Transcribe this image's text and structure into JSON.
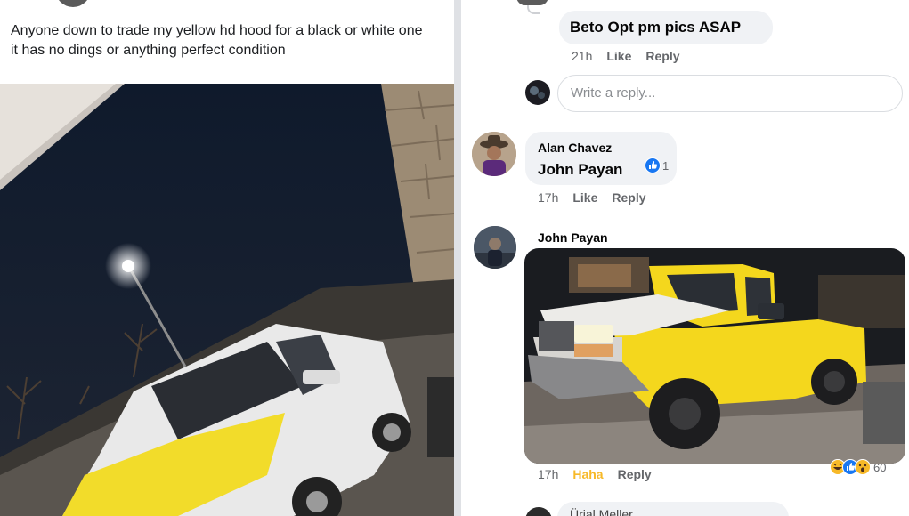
{
  "left_post": {
    "text": "Anyone down to trade my yellow hd hood for a black or white one it has no dings or anything perfect condition",
    "photo": "night photo of white pickup truck with yellow hood parked next to stone wall under street light"
  },
  "right_thread": {
    "reply_beto": {
      "text": "Beto Opt pm pics ASAP",
      "time": "21h",
      "like_label": "Like",
      "reply_label": "Reply"
    },
    "write_reply_placeholder": "Write a reply...",
    "comment_alan": {
      "author": "Alan Chavez",
      "mention": "John Payan",
      "reaction_count": "1",
      "time": "17h",
      "like_label": "Like",
      "reply_label": "Reply"
    },
    "comment_john": {
      "author": "John Payan",
      "photo": "yellow pickup truck with white hood parked at night",
      "time": "17h",
      "haha_label": "Haha",
      "reply_label": "Reply",
      "reaction_count": "60"
    },
    "next_comment_author_partial": "Ürial Meller"
  },
  "colors": {
    "bubble": "#f0f2f5",
    "meta_text": "#65676b",
    "haha": "#f7b928",
    "like_blue": "#1877f2",
    "divider": "#dfe1e5"
  }
}
